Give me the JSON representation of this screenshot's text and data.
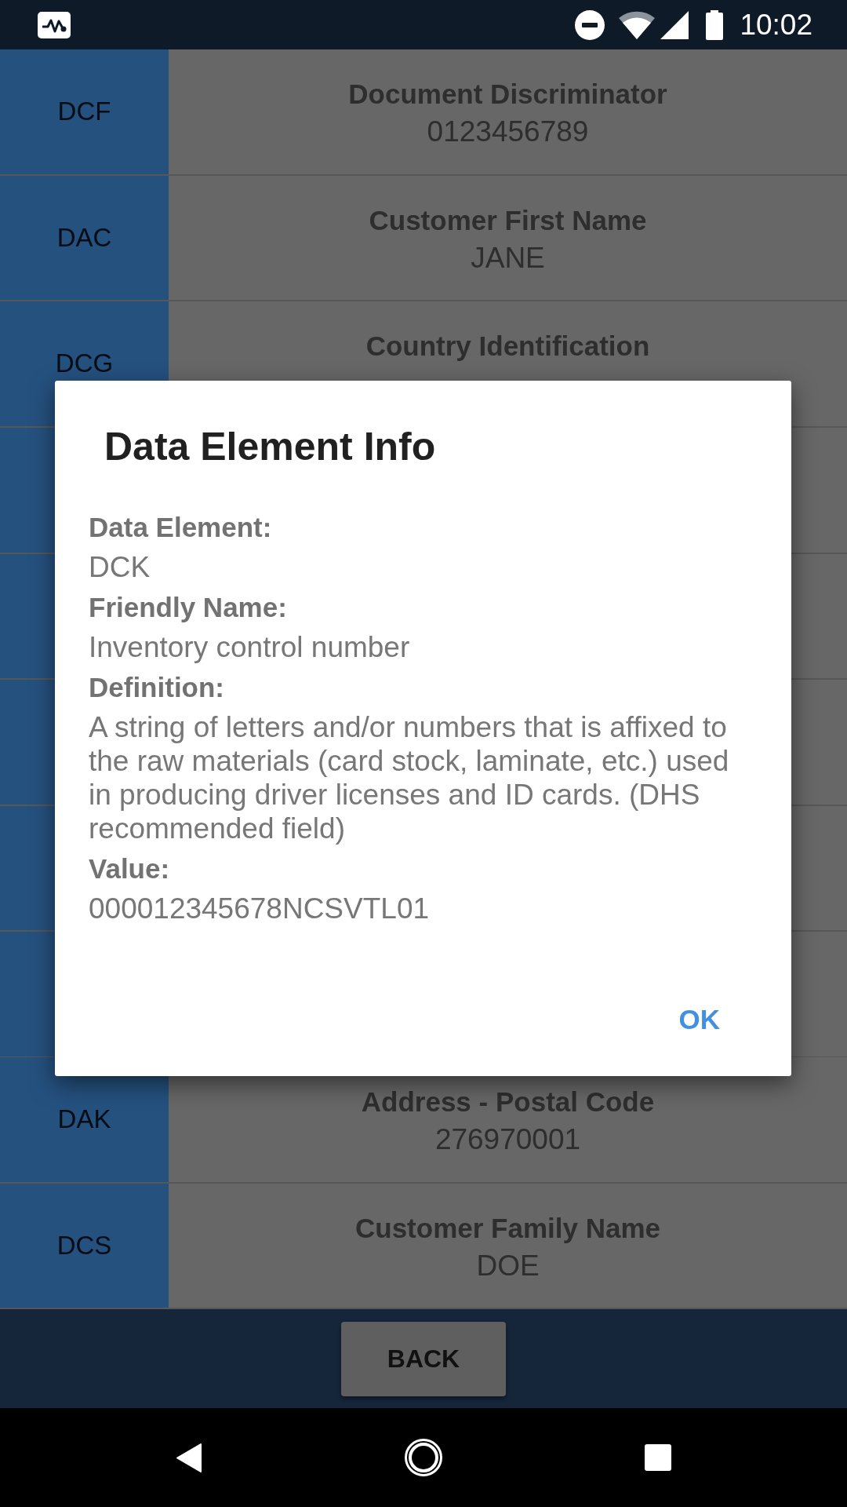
{
  "status_bar": {
    "time": "10:02"
  },
  "list": {
    "top_rows": [
      {
        "code": "DCF",
        "title": "Document Discriminator",
        "value": "0123456789"
      },
      {
        "code": "DAC",
        "title": "Customer First Name",
        "value": "JANE"
      },
      {
        "code": "DCG",
        "title": "Country Identification"
      }
    ],
    "bottom_rows": [
      {
        "code": "DAK",
        "title": "Address - Postal Code",
        "value": "276970001"
      },
      {
        "code": "DCS",
        "title": "Customer Family Name",
        "value": "DOE"
      }
    ]
  },
  "dialog": {
    "title": "Data Element Info",
    "fields": [
      {
        "label": "Data Element:",
        "value": "DCK"
      },
      {
        "label": "Friendly Name:",
        "value": "Inventory control number"
      },
      {
        "label": "Definition:",
        "value": "A string of letters and/or numbers that is affixed to the raw materials (card stock, laminate, etc.) used in producing driver licenses and ID cards. (DHS recommended field)"
      },
      {
        "label": "Value:",
        "value": "000012345678NCSVTL01"
      }
    ],
    "button": "OK"
  },
  "footer": {
    "button": "BACK"
  }
}
